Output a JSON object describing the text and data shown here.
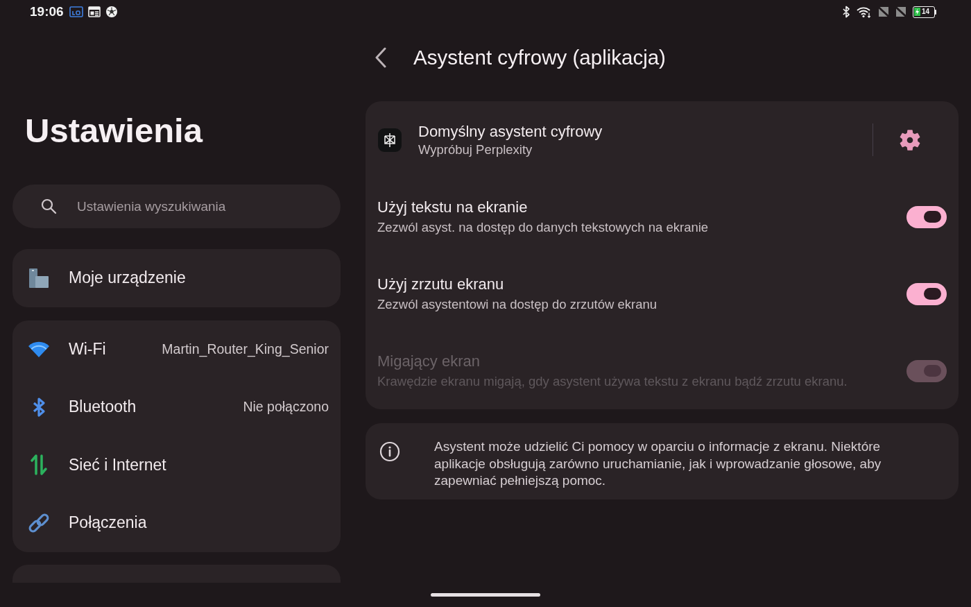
{
  "status_bar": {
    "time": "19:06",
    "battery": {
      "text": "14",
      "charging": true
    }
  },
  "sidebar": {
    "title": "Ustawienia",
    "search": {
      "placeholder": "Ustawienia wyszukiwania"
    },
    "groups": [
      {
        "items": [
          {
            "label": "Moje urządzenie",
            "selected": false
          }
        ]
      },
      {
        "items": [
          {
            "label": "Wi-Fi",
            "value": "Martin_Router_King_Senior",
            "selected": false
          },
          {
            "label": "Bluetooth",
            "value": "Nie połączono",
            "selected": false
          },
          {
            "label": "Sieć i Internet",
            "selected": false
          },
          {
            "label": "Połączenia",
            "selected": false
          }
        ]
      }
    ]
  },
  "page": {
    "title": "Asystent cyfrowy (aplikacja)",
    "settings": [
      {
        "kind": "app",
        "title": "Domyślny asystent cyfrowy",
        "subtitle": "Wypróbuj Perplexity",
        "disabled": false
      },
      {
        "kind": "toggle",
        "title": "Użyj tekstu na ekranie",
        "subtitle": "Zezwól asyst. na dostęp do danych tekstowych na ekranie",
        "on": true,
        "disabled": false
      },
      {
        "kind": "toggle",
        "title": "Użyj zrzutu ekranu",
        "subtitle": "Zezwól asystentowi na dostęp do zrzutów ekranu",
        "on": true,
        "disabled": false
      },
      {
        "kind": "toggle",
        "title": "Migający ekran",
        "subtitle": "Krawędzie ekranu migają, gdy asystent używa tekstu z ekranu bądź zrzutu ekranu.",
        "on": true,
        "disabled": true
      }
    ],
    "info": "Asystent może udzielić Ci pomocy w oparciu o informacje z ekranu. Niektóre aplikacje obsługują zarówno uruchamianie, jak i wprowadzanie głosowe, aby zapewniać pełniejszą pomoc."
  }
}
